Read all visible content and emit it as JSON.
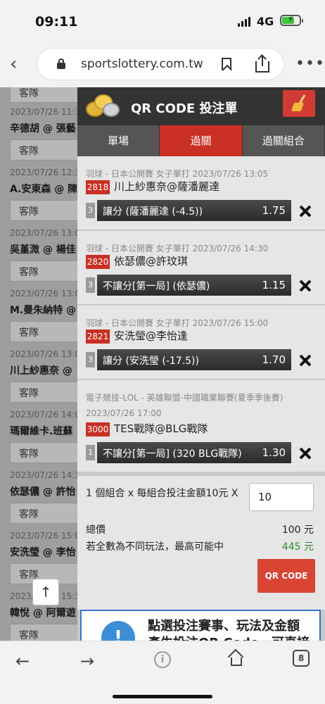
{
  "status_bar": {
    "time": "09:11",
    "network": "4G"
  },
  "browser": {
    "url": "sportslottery.com.tw",
    "open_tabs": "8"
  },
  "background_list": {
    "entries": [
      {
        "date": "",
        "match": "",
        "button": "客隊"
      },
      {
        "date": "2023/07/26 11:3",
        "match": "辛德胡 @ 張藝",
        "button": "客隊"
      },
      {
        "date": "2023/07/26 12:3",
        "match": "A.安東森 @ 陳",
        "button": "客隊"
      },
      {
        "date": "2023/07/26 13:0",
        "match": "吳堇溦 @ 楊佳",
        "button": "客隊"
      },
      {
        "date": "2023/07/26 13:0",
        "match": "M.曼朱納特 @",
        "button": "客隊"
      },
      {
        "date": "2023/07/26 13:0",
        "match": "川上紗惠奈 @",
        "button": "客隊"
      },
      {
        "date": "2023/07/26 14:0",
        "match": "瑪爾維卡.班蘇",
        "button": "客隊"
      },
      {
        "date": "2023/07/26 14:3",
        "match": "依瑟儂 @ 許怡",
        "button": "客隊"
      },
      {
        "date": "2023/07/26 15:0",
        "match": "安洗瑩 @ 李怡",
        "button": "客隊"
      },
      {
        "date": "2023/07/26 15:3",
        "match": "韓悅 @ 阿爾遊",
        "button": "客隊"
      }
    ]
  },
  "panel": {
    "title": "QR CODE 投注單",
    "tabs": [
      {
        "label": "單場",
        "active": false
      },
      {
        "label": "過關",
        "active": true
      },
      {
        "label": "過關組合",
        "active": false
      }
    ],
    "bets": [
      {
        "league": "羽球 - 日本公開賽 女子單打 2023/07/26 13:05",
        "date": "",
        "code": "2818",
        "match": "川上紗惠奈@薩潘麗達",
        "num": "3",
        "pick": "讓分 (薩潘麗達 (-4.5))",
        "odds": "1.75"
      },
      {
        "league": "羽球 - 日本公開賽 女子單打 2023/07/26 14:30",
        "date": "",
        "code": "2820",
        "match": "依瑟儂@許玟琪",
        "num": "3",
        "pick": "不讓分[第一局] (依瑟儂)",
        "odds": "1.15"
      },
      {
        "league": "羽球 - 日本公開賽 女子單打 2023/07/26 15:00",
        "date": "",
        "code": "2821",
        "match": "安洗瑩@李怡逢",
        "num": "3",
        "pick": "讓分 (安洗瑩 (-17.5))",
        "odds": "1.70"
      },
      {
        "league": "電子競技-LOL - 英雄聯盟-中國職業聯賽(夏季季後賽)",
        "date": "2023/07/26 17:00",
        "code": "3000",
        "match": "TES戰隊@BLG戰隊",
        "num": "1",
        "pick": "不讓分[第一局] (320 BLG戰隊)",
        "odds": "1.30"
      }
    ],
    "summary": {
      "combo_text": "1 個組合 x 每組合投注金額10元 X",
      "amount": "10",
      "total_label": "總價",
      "total_value": "100 元",
      "max_label": "若全數為不同玩法，最高可能中",
      "max_value": "445 元",
      "qr_button": "QR CODE"
    },
    "notice": {
      "line1": "點選投注賽事、玩法及金額",
      "line2": "產生投注QR Code，可直接"
    }
  },
  "colors": {
    "accent_red": "#c92f23",
    "win_green": "#2e8b2e",
    "notice_blue": "#3b73c8"
  },
  "icons": [
    "back-chevron-icon",
    "lock-icon",
    "bookmark-icon",
    "share-icon",
    "more-icon",
    "coins-icon",
    "broom-icon",
    "remove-icon",
    "info-icon",
    "up-arrow-icon",
    "forward-arrow-icon",
    "home-icon",
    "tabs-icon"
  ]
}
